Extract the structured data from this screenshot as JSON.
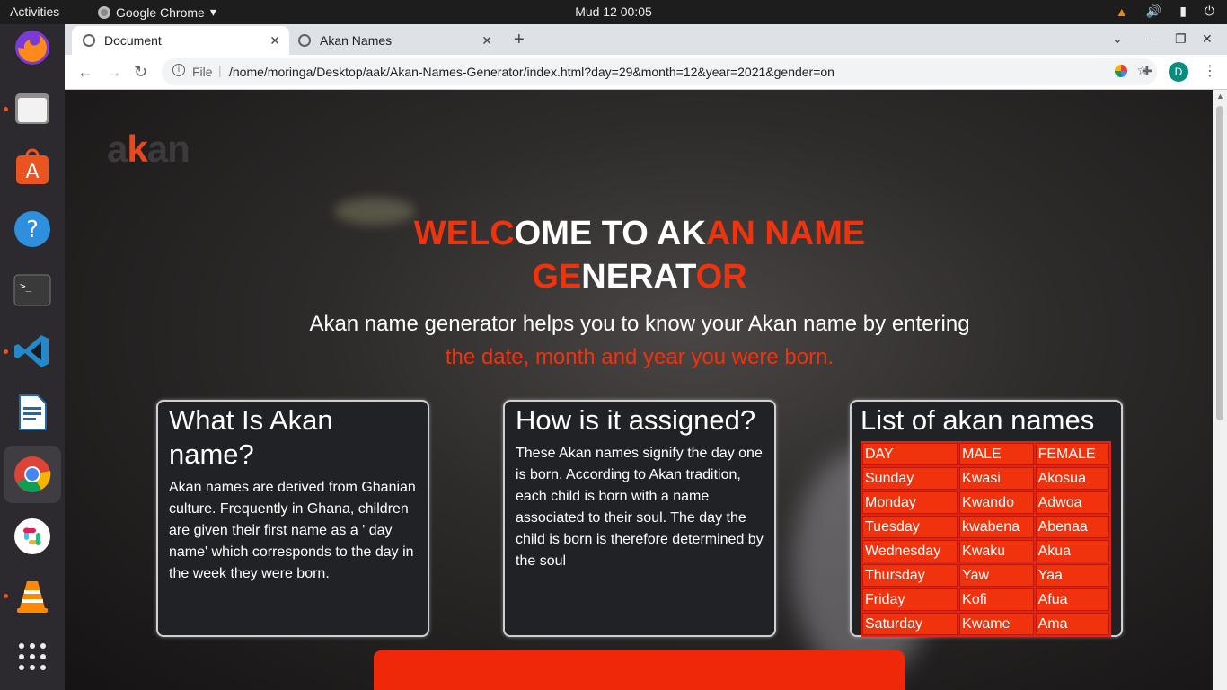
{
  "topbar": {
    "activities": "Activities",
    "app_name": "Google Chrome",
    "clock": "Mud 12  00:05"
  },
  "browser": {
    "tabs": [
      {
        "title": "Document"
      },
      {
        "title": "Akan Names"
      }
    ],
    "address": {
      "scheme_label": "File",
      "url": "/home/moringa/Desktop/aak/Akan-Names-Generator/index.html?day=29&month=12&year=2021&gender=on"
    },
    "profile_initial": "D"
  },
  "page": {
    "logo": {
      "part1": "a",
      "part2": "k",
      "part3": "an"
    },
    "headline": {
      "s1": "WELC",
      "s2": "OME TO AK",
      "s3": "AN NAME",
      "s4": "GE",
      "s5": "NERAT",
      "s6": "OR"
    },
    "subtitle": {
      "line1": "Akan name generator helps you to know your Akan name by entering",
      "line2": "the date, month and year you were born."
    },
    "cards": [
      {
        "title": "What Is Akan name?",
        "text": "Akan names are derived from Ghanian culture. Frequently in Ghana, children are given their first name as a ' day name' which corresponds to the day in the week they were born."
      },
      {
        "title": "How is it assigned?",
        "text": "These Akan names signify the day one is born. According to Akan tradition, each child is born with a name associated to their soul. The day the child is born is therefore determined by the soul"
      },
      {
        "title": "List of akan names"
      }
    ],
    "names_table": {
      "headers": [
        "DAY",
        "MALE",
        "FEMALE"
      ],
      "rows": [
        [
          "Sunday",
          "Kwasi",
          "Akosua"
        ],
        [
          "Monday",
          "Kwando",
          "Adwoa"
        ],
        [
          "Tuesday",
          "kwabena",
          "Abenaa"
        ],
        [
          "Wednesday",
          "Kwaku",
          "Akua"
        ],
        [
          "Thursday",
          "Yaw",
          "Yaa"
        ],
        [
          "Friday",
          "Kofi",
          "Afua"
        ],
        [
          "Saturday",
          "Kwame",
          "Ama"
        ]
      ]
    }
  },
  "colors": {
    "accent_red": "#f0330d",
    "card_bg": "#212226"
  }
}
